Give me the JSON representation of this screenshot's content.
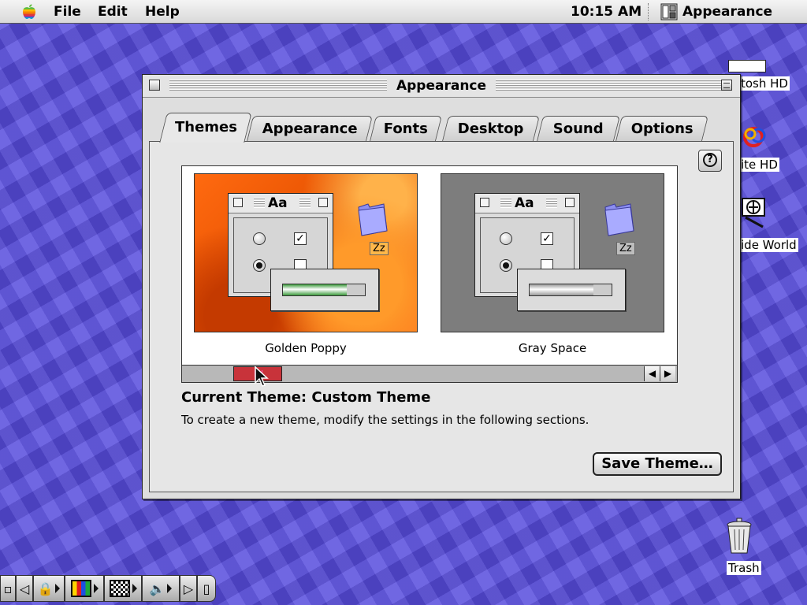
{
  "menubar": {
    "menus": [
      "File",
      "Edit",
      "Help"
    ],
    "clock": "10:15 AM",
    "app_name": "Appearance"
  },
  "desktop": {
    "icons": [
      {
        "label": "tosh HD",
        "icon": "hard-disk-icon"
      },
      {
        "label": "ite HD",
        "icon": "colorful-disk-icon"
      },
      {
        "label": "ide World",
        "icon": "globe-icon"
      },
      {
        "label": "Trash",
        "icon": "trash-icon"
      }
    ]
  },
  "window": {
    "title": "Appearance",
    "tabs": [
      {
        "label": "Themes",
        "active": true
      },
      {
        "label": "Appearance"
      },
      {
        "label": "Fonts"
      },
      {
        "label": "Desktop"
      },
      {
        "label": "Sound"
      },
      {
        "label": "Options"
      }
    ],
    "themes": [
      {
        "name": "Golden Poppy",
        "progress_color": "#3c9a3c",
        "progress_fill_fraction": 0.78
      },
      {
        "name": "Gray Space",
        "progress_color": "#9a9a9a",
        "progress_fill_fraction": 0.78
      }
    ],
    "mini_title": "Aa",
    "folder_label": "Zz",
    "current_theme": "Current Theme: Custom Theme",
    "hint": "To create a new theme, modify the settings in the following sections.",
    "save_button": "Save Theme…"
  },
  "colors": {
    "scroll_thumb": "#c8333a",
    "desktop": "#5a4fd0"
  }
}
